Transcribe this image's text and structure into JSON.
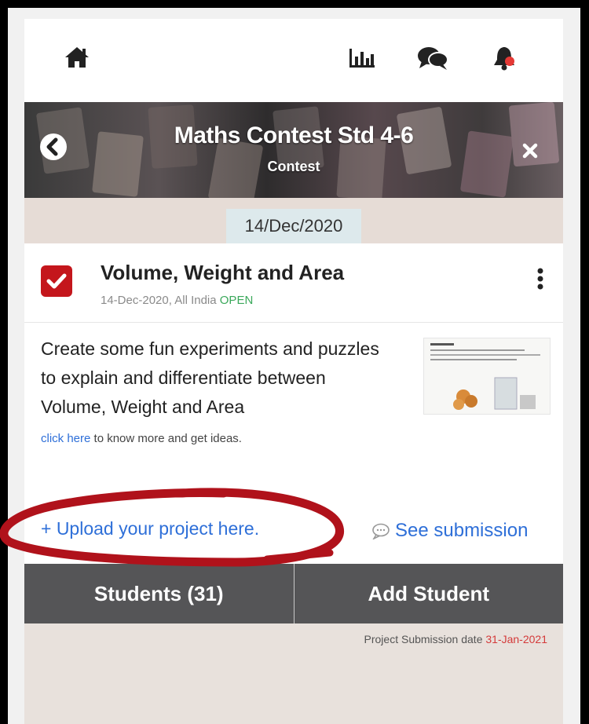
{
  "topbar": {
    "icons": [
      "home-icon",
      "bar-chart-icon",
      "chat-icon",
      "bell-icon"
    ],
    "notification_color": "#e53935"
  },
  "banner": {
    "title": "Maths Contest Std 4-6",
    "subtitle": "Contest"
  },
  "date_pill": "14/Dec/2020",
  "project": {
    "title": "Volume, Weight and Area",
    "meta_prefix": "14-Dec-2020, All India",
    "status": "OPEN",
    "description": "Create some fun experiments and puzzles to explain and differentiate between Volume, Weight and Area",
    "more_link": "click here",
    "more_text": " to know more and get ideas."
  },
  "upload_label": "+ Upload your project here.",
  "see_submission_label": "See submission",
  "buttons": {
    "students": "Students (31)",
    "add_student": "Add Student"
  },
  "submission": {
    "label": "Project Submission date",
    "date": "31-Jan-2021"
  },
  "colors": {
    "accent_red": "#c4161c",
    "link_blue": "#2e6fd8",
    "open_green": "#3aa85a",
    "button_bar": "#555557",
    "annotation_red": "#b0121b"
  }
}
